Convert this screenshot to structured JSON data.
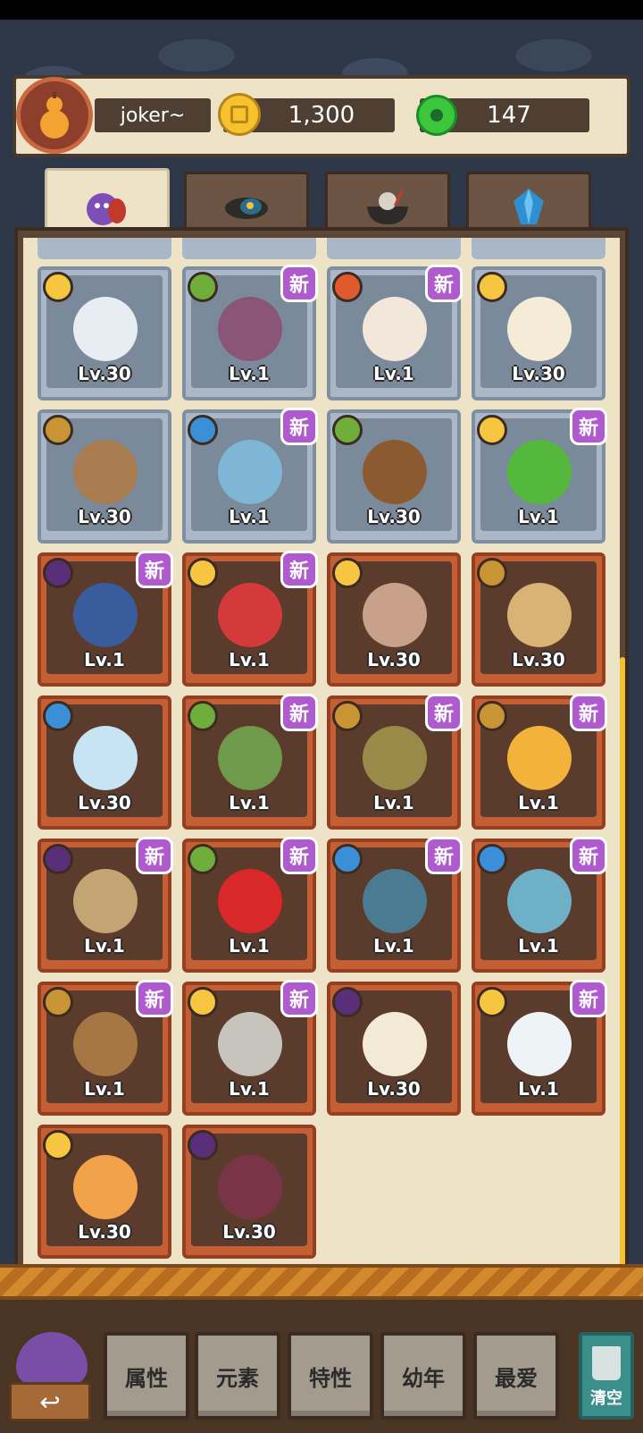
{
  "header": {
    "username": "joker~",
    "coins": "1,300",
    "gems": "147"
  },
  "tabs": [
    {
      "name": "monsters",
      "active": true
    },
    {
      "name": "equipment",
      "active": false
    },
    {
      "name": "food",
      "active": false
    },
    {
      "name": "crystals",
      "active": false
    }
  ],
  "cards": [
    {
      "style": "blue",
      "element": "sun",
      "level": "Lv.30",
      "new": false,
      "tint": "#e8edf3"
    },
    {
      "style": "blue",
      "element": "leaf",
      "level": "Lv.1",
      "new": true,
      "tint": "#8a5577"
    },
    {
      "style": "blue",
      "element": "fire",
      "level": "Lv.1",
      "new": true,
      "tint": "#f3e6da"
    },
    {
      "style": "blue",
      "element": "sun",
      "level": "Lv.30",
      "new": false,
      "tint": "#f4ecd6"
    },
    {
      "style": "blue",
      "element": "earth",
      "level": "Lv.30",
      "new": false,
      "tint": "#a97c4f"
    },
    {
      "style": "blue",
      "element": "water",
      "level": "Lv.1",
      "new": true,
      "tint": "#7fb6d6"
    },
    {
      "style": "blue",
      "element": "leaf",
      "level": "Lv.30",
      "new": false,
      "tint": "#8b5a2e"
    },
    {
      "style": "blue",
      "element": "sun",
      "level": "Lv.1",
      "new": true,
      "tint": "#53b83c"
    },
    {
      "style": "brown",
      "element": "moon",
      "level": "Lv.1",
      "new": true,
      "tint": "#3a5c9c"
    },
    {
      "style": "brown",
      "element": "sun",
      "level": "Lv.1",
      "new": true,
      "tint": "#d53a3a"
    },
    {
      "style": "brown",
      "element": "sun",
      "level": "Lv.30",
      "new": false,
      "tint": "#c9a089"
    },
    {
      "style": "brown",
      "element": "earth",
      "level": "Lv.30",
      "new": false,
      "tint": "#d9b275"
    },
    {
      "style": "brown",
      "element": "water",
      "level": "Lv.30",
      "new": false,
      "tint": "#c6e4f3"
    },
    {
      "style": "brown",
      "element": "leaf",
      "level": "Lv.1",
      "new": true,
      "tint": "#6e9a4a"
    },
    {
      "style": "brown",
      "element": "earth",
      "level": "Lv.1",
      "new": true,
      "tint": "#9a8a4a"
    },
    {
      "style": "brown",
      "element": "earth",
      "level": "Lv.1",
      "new": true,
      "tint": "#f3b23a"
    },
    {
      "style": "brown",
      "element": "moon",
      "level": "Lv.1",
      "new": true,
      "tint": "#c3a574"
    },
    {
      "style": "brown",
      "element": "leaf",
      "level": "Lv.1",
      "new": true,
      "tint": "#d8282a"
    },
    {
      "style": "brown",
      "element": "water",
      "level": "Lv.1",
      "new": true,
      "tint": "#4a7b90"
    },
    {
      "style": "brown",
      "element": "water",
      "level": "Lv.1",
      "new": true,
      "tint": "#6fb0c9"
    },
    {
      "style": "brown",
      "element": "earth",
      "level": "Lv.1",
      "new": true,
      "tint": "#a67643"
    },
    {
      "style": "brown",
      "element": "sun",
      "level": "Lv.1",
      "new": true,
      "tint": "#c7c4bd"
    },
    {
      "style": "brown",
      "element": "moon",
      "level": "Lv.30",
      "new": false,
      "tint": "#f3ead6"
    },
    {
      "style": "brown",
      "element": "sun",
      "level": "Lv.1",
      "new": true,
      "tint": "#eef3f6"
    },
    {
      "style": "brown",
      "element": "sun",
      "level": "Lv.30",
      "new": false,
      "tint": "#f2a24a"
    },
    {
      "style": "brown",
      "element": "moon",
      "level": "Lv.30",
      "new": false,
      "tint": "#7a3448"
    }
  ],
  "new_label": "新",
  "filters": [
    {
      "label": "属性"
    },
    {
      "label": "元素"
    },
    {
      "label": "特性"
    },
    {
      "label": "幼年"
    },
    {
      "label": "最爱"
    }
  ],
  "clear_label": "清空",
  "back_arrow": "↩"
}
